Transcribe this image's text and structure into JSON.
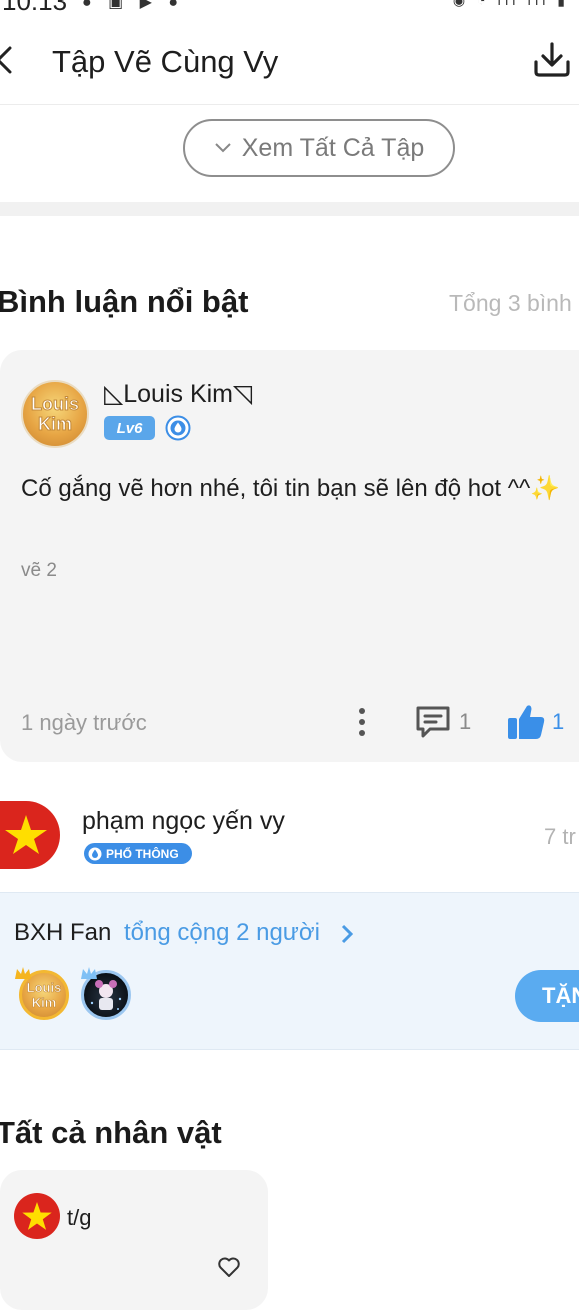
{
  "status_bar": {
    "time": "10:13"
  },
  "header": {
    "title": "Tập Vẽ Cùng Vy"
  },
  "episodes_button": {
    "label": "Xem Tất Cả Tập"
  },
  "featured_comments": {
    "title": "Bình luận nổi bật",
    "total": "Tổng 3 bình l"
  },
  "comment": {
    "avatar_text_1": "Louis",
    "avatar_text_2": "Kim",
    "author": "◺Louis Kim◹",
    "level": "Lv6",
    "text": "Cố gắng vẽ hơn nhé, tôi tin bạn sẽ lên độ hot ^^✨",
    "episode": "vẽ 2",
    "time": "1 ngày trước",
    "reply_count": "1",
    "like_count": "1"
  },
  "comment2": {
    "author": "phạm ngọc yến vy",
    "rank": "PHỔ THÔNG",
    "time": "7 tr"
  },
  "fan_ranking": {
    "title": "BXH Fan",
    "total": "tổng cộng 2 người",
    "fan1_text_1": "Louis",
    "fan1_text_2": "Kim",
    "gift_label": "TẶN"
  },
  "characters": {
    "title": "Tất cả nhân vật",
    "items": [
      {
        "name": "t/g"
      }
    ]
  },
  "colors": {
    "accent_blue": "#3a8fe8",
    "flag_red": "#da251d",
    "flag_star": "#ffde00"
  }
}
